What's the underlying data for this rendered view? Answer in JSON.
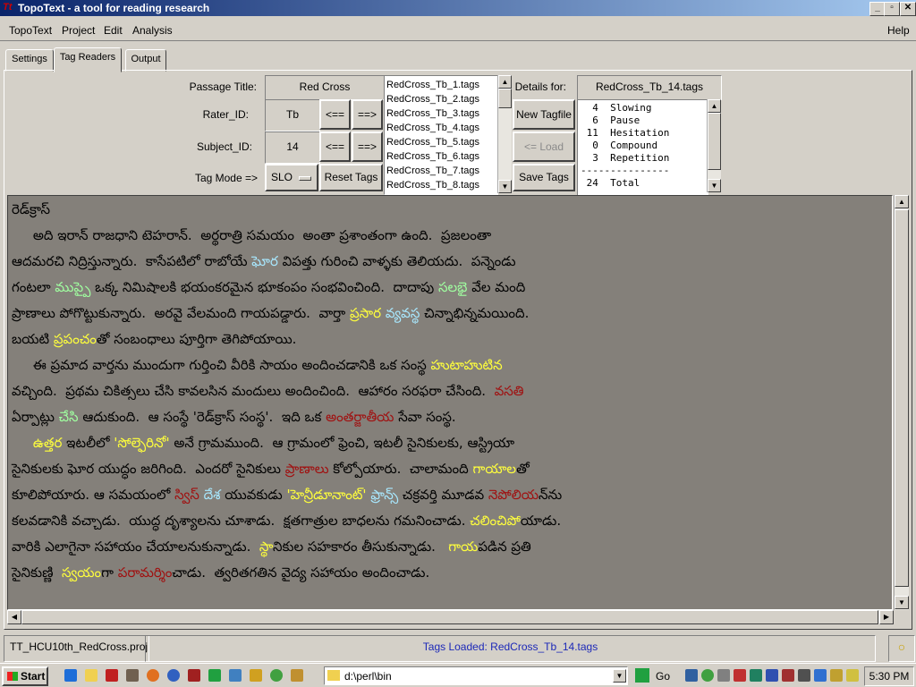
{
  "window": {
    "title": "TopoText - a tool for reading research",
    "icon_letter": "Tt",
    "buttons": [
      "_",
      "▫",
      "✕"
    ]
  },
  "menu": {
    "items": [
      "TopoText",
      "Project",
      "Edit",
      "Analysis"
    ],
    "help": "Help"
  },
  "tabs": [
    {
      "label": "Settings"
    },
    {
      "label": "Tag Readers",
      "active": true
    },
    {
      "label": "Output"
    }
  ],
  "form": {
    "passage_title_label": "Passage Title:",
    "passage_title_value": "Red Cross",
    "rater_label": "Rater_ID:",
    "rater_value": "Tb",
    "subject_label": "Subject_ID:",
    "subject_value": "14",
    "tagmode_label": "Tag Mode =>",
    "tagmode_value": "SLO",
    "prev_label": "<==",
    "next_label": "==>",
    "reset_label": "Reset Tags",
    "new_tagfile_label": "New Tagfile",
    "load_label": "<= Load",
    "save_label": "Save Tags",
    "details_label": "Details for:",
    "details_file": "RedCross_Tb_14.tags"
  },
  "tagfiles": [
    "RedCross_Tb_1.tags",
    "RedCross_Tb_2.tags",
    "RedCross_Tb_3.tags",
    "RedCross_Tb_4.tags",
    "RedCross_Tb_5.tags",
    "RedCross_Tb_6.tags",
    "RedCross_Tb_7.tags",
    "RedCross_Tb_8.tags"
  ],
  "details": [
    "  4  Slowing",
    "  6  Pause",
    " 11  Hesitation",
    "  0  Compound",
    "  3  Repetition",
    "---------------",
    " 24  Total"
  ],
  "text_lines": [
    [
      [
        "రెడ్‌క్రాస్",
        ""
      ]
    ],
    [
      [
        "     అది ఇరాన్ రాజధాని టెహరాన్.  అర్థరాత్రి సమయం  అంతా ప్రశాంతంగా ఉంది.  ప్రజలంతా",
        ""
      ]
    ],
    [
      [
        "ఆదమరచి నిద్రిస్తున్నారు.  కాసేపటిలో రాబోయే ",
        ""
      ],
      [
        "ఘోర",
        "blue"
      ],
      [
        " విపత్తు గురించి వాళ్ళకు తెలియదు.  పన్నెండు",
        ""
      ]
    ],
    [
      [
        "గంటలా ",
        ""
      ],
      [
        "ముప్పై",
        "green"
      ],
      [
        " ఒక్క నిమిషాలకి భయంకరమైన భూకంపం సంభవించింది.  దాదాపు ",
        ""
      ],
      [
        "సలభై",
        "green"
      ],
      [
        " వేల మంది",
        ""
      ]
    ],
    [
      [
        "ప్రాణాలు పోగొట్టుకున్నారు.  అరవై వేలమంది గాయపడ్డారు.  వార్తా ",
        ""
      ],
      [
        "ప్రసార",
        "yellow"
      ],
      [
        " ",
        ""
      ],
      [
        "వ్యవస్థ",
        "blue"
      ],
      [
        " చిన్నాభిన్నమయింది.",
        ""
      ]
    ],
    [
      [
        "బయటి ",
        ""
      ],
      [
        "ప్రపంచం",
        "yellow"
      ],
      [
        "తో సంబంధాలు పూర్తిగా తెగిపోయాయి.",
        ""
      ]
    ],
    [
      [
        "     ఈ ప్రమాద వార్తను ముందుగా గుర్తించి వీరికి సాయం అందించడానికి ఒక సంస్థ ",
        ""
      ],
      [
        "హుటాహుటిన",
        "yellow"
      ]
    ],
    [
      [
        "వచ్చింది.  ప్రథమ చికిత్సలు చేసి కావలసిన మందులు అందించింది.  ఆహారం సరఫరా చేసింది.  ",
        ""
      ],
      [
        "వసతి",
        "red"
      ]
    ],
    [
      [
        "ఏర్పాట్లు ",
        ""
      ],
      [
        "చేసి",
        "green"
      ],
      [
        " ఆదుకుంది.  ఆ సంస్థే 'రెడ్‌క్రాస్ సంస్థ'.  ఇది ఒక ",
        ""
      ],
      [
        "అంతర్జాతీయ",
        "red"
      ],
      [
        " సేవా సంస్థ.",
        ""
      ]
    ],
    [
      [
        "     ",
        ""
      ],
      [
        "ఉత్తర",
        "yellow"
      ],
      [
        " ఇటలీలో ",
        ""
      ],
      [
        "'సోల్ఫెరినో'",
        "yellow"
      ],
      [
        " అనే గ్రామముంది.  ఆ గ్రామంలో ఫ్రెంచి, ఇటలీ సైనికులకు, ఆస్ట్రియా",
        ""
      ]
    ],
    [
      [
        "సైనికులకు ఘోర యుద్ధం జరిగింది.  ఎందరో సైనికులు ",
        ""
      ],
      [
        "ప్రాణాలు",
        "red"
      ],
      [
        " కోల్పోయారు.  చాలామంది ",
        ""
      ],
      [
        "గాయాల",
        "yellow"
      ],
      [
        "తో",
        ""
      ]
    ],
    [
      [
        "కూలిపోయారు. ఆ సమయంలో ",
        ""
      ],
      [
        "స్విస్",
        "red"
      ],
      [
        " ",
        ""
      ],
      [
        "దేశ",
        "blue"
      ],
      [
        " యువకుడు ",
        ""
      ],
      [
        "'హెన్రీడూనాంట్'",
        "yellow"
      ],
      [
        " ",
        ""
      ],
      [
        "ఫ్రాన్స్",
        "blue"
      ],
      [
        " చక్రవర్తి మూడవ ",
        ""
      ],
      [
        "నెపోలియ",
        "red"
      ],
      [
        "న్‌ను",
        ""
      ]
    ],
    [
      [
        "కలవడానికి వచ్చాడు.  యుద్ధ దృశ్యాలను చూశాడు.  క్షతగాత్రుల బాధలను గమనించాడు. ",
        ""
      ],
      [
        "చలించిపో",
        "yellow"
      ],
      [
        "యాడు.",
        ""
      ]
    ],
    [
      [
        "వారికి ఎలాగైనా సహాయం చేయాలనుకున్నాడు.  ",
        ""
      ],
      [
        "స్థా",
        "yellow"
      ],
      [
        "నికుల సహకారం తీసుకున్నాడు.   ",
        ""
      ],
      [
        "గాయ",
        "yellow"
      ],
      [
        "పడిన ప్రతి",
        ""
      ]
    ],
    [
      [
        "సైనికుణ్ణి  ",
        ""
      ],
      [
        "స్వయం",
        "yellow"
      ],
      [
        "గా ",
        ""
      ],
      [
        "పరామర్శిం",
        "red"
      ],
      [
        "చాడు.  త్వరితగతిన వైద్య సహాయం అందించాడు.",
        ""
      ]
    ]
  ],
  "status": {
    "project": "TT_HCU10th_RedCross.proj",
    "message": "Tags Loaded:  RedCross_Tb_14.tags"
  },
  "taskbar": {
    "start": "Start",
    "address": "d:\\perl\\bin",
    "go": "Go",
    "clock": "5:30 PM"
  },
  "colors": {
    "text_bg": "#84807a",
    "yellow": "#ffff3c",
    "red": "#a01010",
    "green": "#a0ffa0",
    "blue": "#a8e8ff"
  }
}
